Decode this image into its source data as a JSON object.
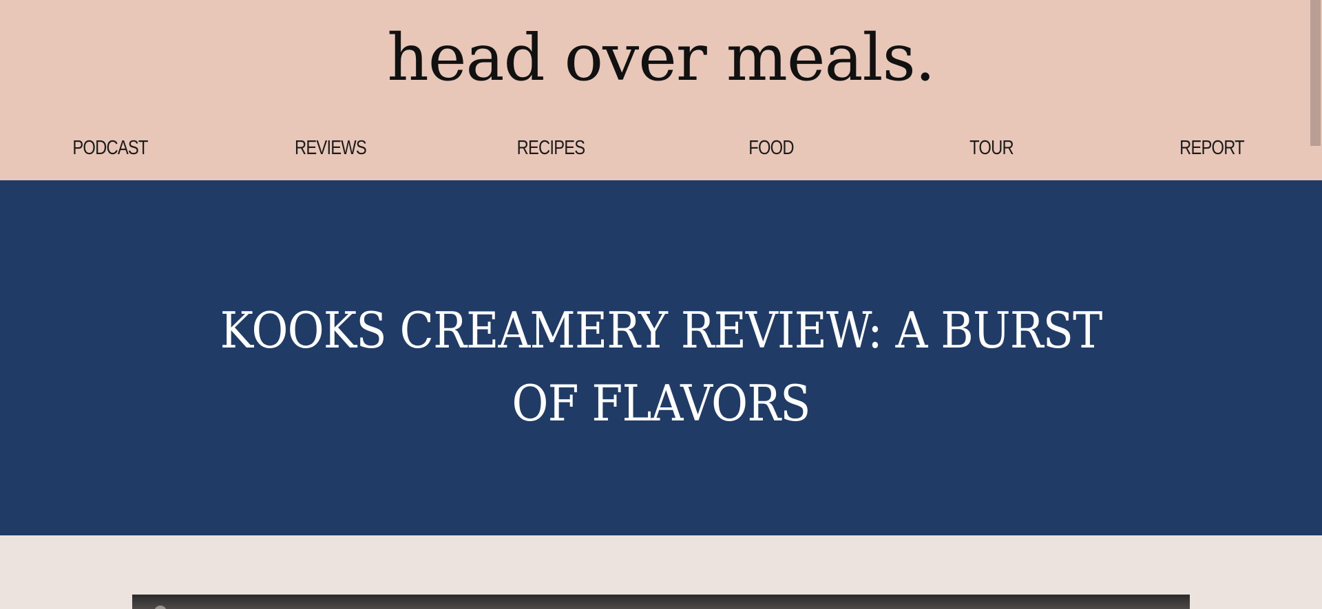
{
  "site": {
    "title": "head over meals."
  },
  "nav": {
    "items": [
      {
        "label": "PODCAST"
      },
      {
        "label": "REVIEWS"
      },
      {
        "label": "RECIPES"
      },
      {
        "label": "FOOD"
      },
      {
        "label": "TOUR"
      },
      {
        "label": "REPORT"
      }
    ]
  },
  "hero": {
    "title": "KOOKS CREAMERY REVIEW: A BURST OF FLAVORS"
  },
  "colors": {
    "header_bg": "#e8c7b8",
    "hero_bg": "#1f3b66",
    "content_bg": "#ece2de",
    "text_dark": "#111111",
    "text_light": "#ffffff"
  },
  "icons": {
    "media_corner": "play-icon"
  }
}
